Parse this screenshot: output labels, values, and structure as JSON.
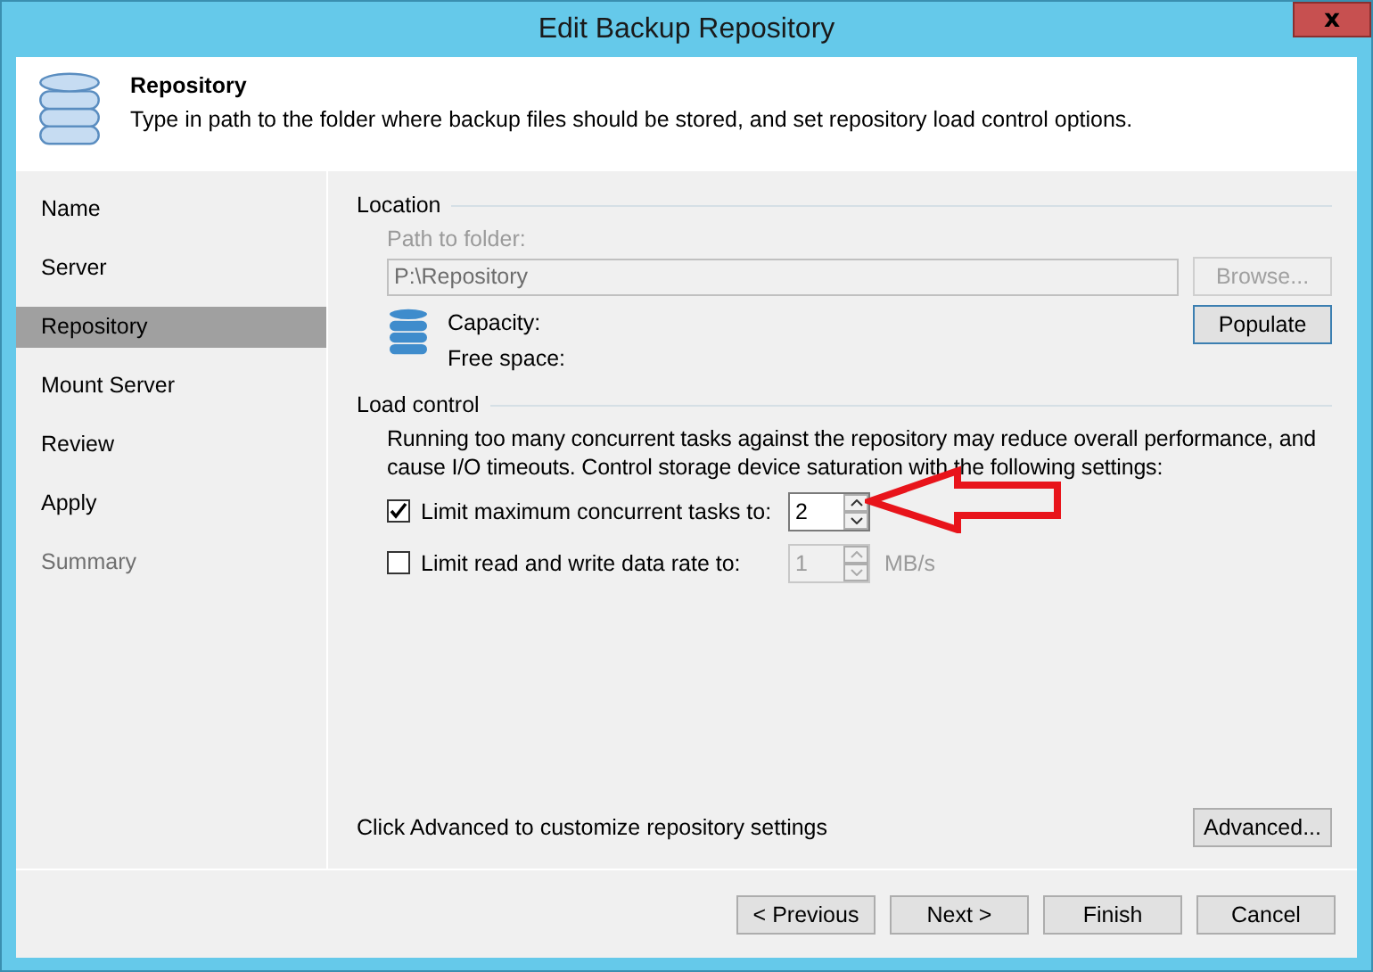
{
  "window": {
    "title": "Edit Backup Repository",
    "close": "x"
  },
  "header": {
    "title": "Repository",
    "description": "Type in path to the folder where backup files should be stored, and set repository load control options."
  },
  "steps": [
    {
      "label": "Name",
      "selected": false,
      "disabled": false
    },
    {
      "label": "Server",
      "selected": false,
      "disabled": false
    },
    {
      "label": "Repository",
      "selected": true,
      "disabled": false
    },
    {
      "label": "Mount Server",
      "selected": false,
      "disabled": false
    },
    {
      "label": "Review",
      "selected": false,
      "disabled": false
    },
    {
      "label": "Apply",
      "selected": false,
      "disabled": false
    },
    {
      "label": "Summary",
      "selected": false,
      "disabled": true
    }
  ],
  "location": {
    "heading": "Location",
    "path_label": "Path to folder:",
    "path_value": "P:\\Repository",
    "disabled": true,
    "browse_button": "Browse...",
    "capacity_label": "Capacity:",
    "free_space_label": "Free space:",
    "populate_button": "Populate"
  },
  "load_control": {
    "heading": "Load control",
    "description": "Running too many concurrent tasks against the repository may reduce overall performance, and cause I/O timeouts. Control storage device saturation with the following settings:",
    "options": [
      {
        "label": "Limit maximum concurrent tasks to:",
        "checked": true,
        "value": "2"
      },
      {
        "label": "Limit read and write data rate to:",
        "checked": false,
        "value": "1",
        "unit": "MB/s"
      }
    ]
  },
  "advanced": {
    "text": "Click Advanced to customize repository settings",
    "button": "Advanced..."
  },
  "buttons": [
    {
      "label": "< Previous"
    },
    {
      "label": "Next >"
    },
    {
      "label": "Finish"
    },
    {
      "label": "Cancel"
    }
  ]
}
